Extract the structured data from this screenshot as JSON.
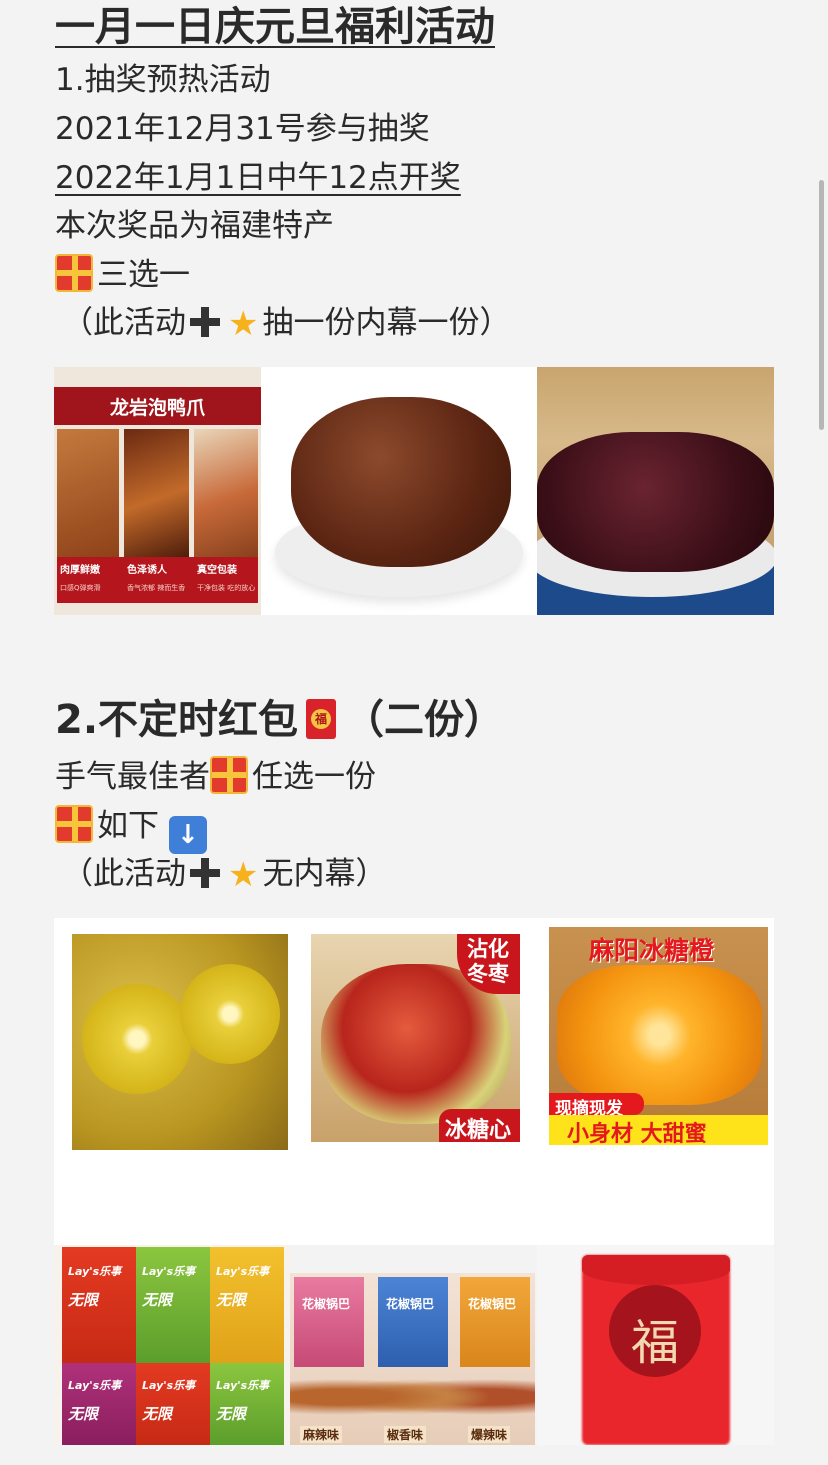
{
  "title": "一月一日庆元旦福利活动",
  "section1": {
    "heading": "1.抽奖预热活动",
    "line_date": "2021年12月31号参与抽奖",
    "line_draw": "2022年1月1日中午12点开奖",
    "line_prize": "本次奖品为福建特产",
    "choose": "三选一",
    "note_left": "（此活动",
    "note_right": "抽一份内幕一份）"
  },
  "section1_images": {
    "duck": {
      "title": "龙岩泡鸭爪",
      "labels": [
        "肉厚鲜嫩",
        "色泽诱人",
        "真空包装"
      ],
      "sublabels": [
        "口感Q弹爽滑",
        "香气浓郁 辣而生香",
        "干净包装 吃的放心"
      ]
    }
  },
  "section2": {
    "heading": "2.不定时红包",
    "heading_suffix": "（二份）",
    "line_winner": "手气最佳者",
    "line_winner_suffix": "任选一份",
    "line_below": "如下",
    "note_left": "（此活动",
    "note_right": "无内幕）"
  },
  "section2_images": {
    "jujube": {
      "badge": "沾化冬枣",
      "bottom": "冰糖心"
    },
    "orange": {
      "title": "麻阳冰糖橙",
      "tag": "现摘现发",
      "bottom": "小身材 大甜蜜"
    },
    "chips": {
      "brand": "Lay's乐事",
      "series": "无限"
    },
    "crackers": {
      "name": "花椒锅巴",
      "flavors": [
        "麻辣味",
        "椒香味",
        "爆辣味"
      ]
    },
    "envelope": {
      "char": "福"
    }
  },
  "icons": [
    "gift-icon",
    "plus-icon",
    "star-icon",
    "red-envelope-icon",
    "down-arrow-icon"
  ]
}
